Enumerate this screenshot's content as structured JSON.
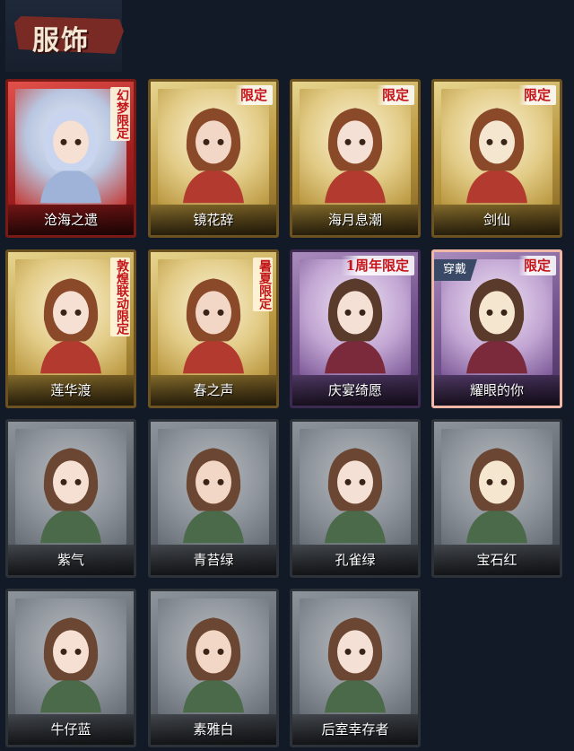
{
  "header": {
    "title": "服饰"
  },
  "cards": [
    {
      "name": "沧海之遗",
      "tag": "幻梦限定",
      "style": "red",
      "tag_vertical": true
    },
    {
      "name": "镜花辞",
      "tag": "限定",
      "style": "gold"
    },
    {
      "name": "海月息潮",
      "tag": "限定",
      "style": "gold"
    },
    {
      "name": "剑仙",
      "tag": "限定",
      "style": "gold"
    },
    {
      "name": "莲华渡",
      "tag": "敦煌联动限定",
      "style": "gold",
      "tag_vertical": true
    },
    {
      "name": "春之声",
      "tag": "暑夏限定",
      "style": "gold",
      "tag_vertical": true
    },
    {
      "name": "庆宴绮愿",
      "tag": "1周年限定",
      "style": "purple"
    },
    {
      "name": "耀眼的你",
      "tag": "限定",
      "style": "purple",
      "worn_label": "穿戴"
    },
    {
      "name": "紫气",
      "tag": "",
      "style": "grey"
    },
    {
      "name": "青苔绿",
      "tag": "",
      "style": "grey"
    },
    {
      "name": "孔雀绿",
      "tag": "",
      "style": "grey"
    },
    {
      "name": "宝石红",
      "tag": "",
      "style": "grey"
    },
    {
      "name": "牛仔蓝",
      "tag": "",
      "style": "grey"
    },
    {
      "name": "素雅白",
      "tag": "",
      "style": "grey"
    },
    {
      "name": "后室幸存者",
      "tag": "",
      "style": "grey"
    }
  ],
  "colors": {
    "background": "#121a27",
    "limited_tag": "#c4141a",
    "header_brush": "#7a2a24"
  }
}
